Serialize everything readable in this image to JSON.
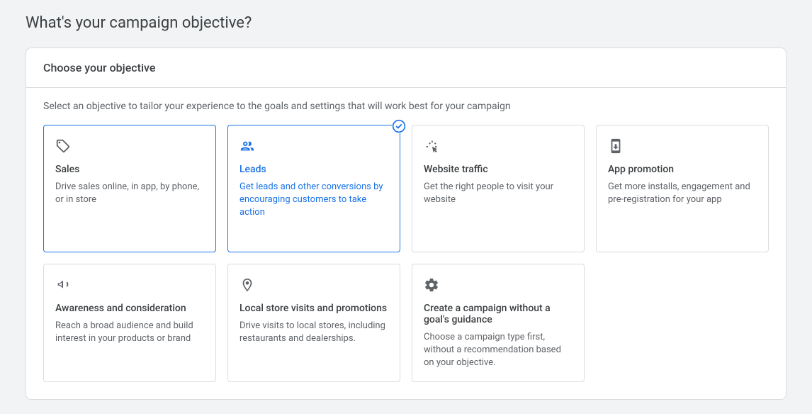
{
  "page": {
    "title": "What's your campaign objective?"
  },
  "panel": {
    "header": "Choose your objective",
    "instruction": "Select an objective to tailor your experience to the goals and settings that will work best for your campaign"
  },
  "objectives": [
    {
      "id": "sales",
      "title": "Sales",
      "desc": "Drive sales online, in app, by phone, or in store",
      "highlighted": true,
      "selected": false
    },
    {
      "id": "leads",
      "title": "Leads",
      "desc": "Get leads and other conversions by encouraging customers to take action",
      "highlighted": true,
      "selected": true
    },
    {
      "id": "website-traffic",
      "title": "Website traffic",
      "desc": "Get the right people to visit your website",
      "highlighted": false,
      "selected": false
    },
    {
      "id": "app-promotion",
      "title": "App promotion",
      "desc": "Get more installs, engagement and pre-registration for your app",
      "highlighted": false,
      "selected": false
    },
    {
      "id": "awareness",
      "title": "Awareness and consideration",
      "desc": "Reach a broad audience and build interest in your products or brand",
      "highlighted": false,
      "selected": false
    },
    {
      "id": "local-store",
      "title": "Local store visits and promotions",
      "desc": "Drive visits to local stores, including restaurants and dealerships.",
      "highlighted": false,
      "selected": false
    },
    {
      "id": "no-goal",
      "title": "Create a campaign without a goal's guidance",
      "desc": "Choose a campaign type first, without a recommendation based on your objective.",
      "highlighted": false,
      "selected": false
    }
  ],
  "colors": {
    "accent": "#1a73e8",
    "border": "#dadce0",
    "text_primary": "#3c4043",
    "text_secondary": "#5f6368",
    "page_bg": "#f1f3f4"
  }
}
